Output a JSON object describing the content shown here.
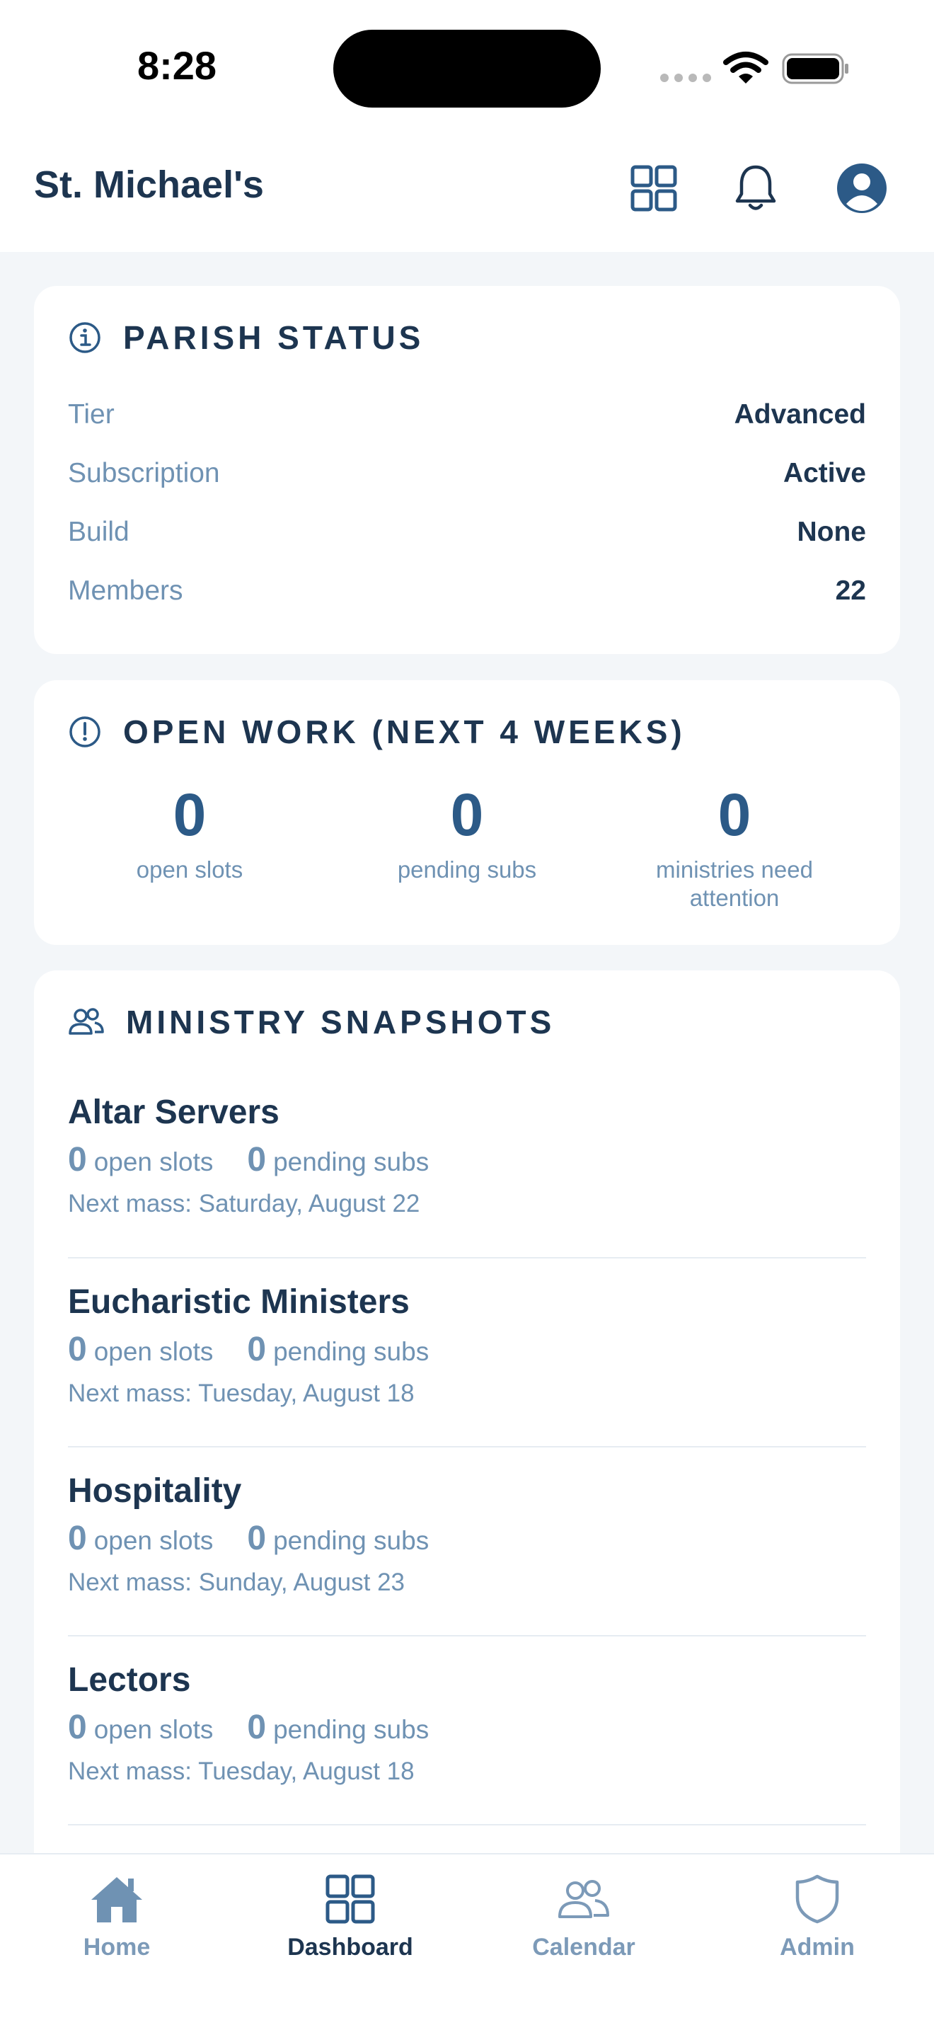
{
  "status_bar": {
    "time": "8:28"
  },
  "header": {
    "title": "St. Michael's"
  },
  "parish_status": {
    "title": "PARISH STATUS",
    "rows": [
      {
        "label": "Tier",
        "value": "Advanced"
      },
      {
        "label": "Subscription",
        "value": "Active"
      },
      {
        "label": "Build",
        "value": "None"
      },
      {
        "label": "Members",
        "value": "22"
      }
    ]
  },
  "open_work": {
    "title": "OPEN WORK (NEXT 4 WEEKS)",
    "stats": [
      {
        "value": "0",
        "label": "open slots"
      },
      {
        "value": "0",
        "label": "pending subs"
      },
      {
        "value": "0",
        "label": "ministries need attention"
      }
    ]
  },
  "ministry_snapshots": {
    "title": "MINISTRY SNAPSHOTS",
    "open_label": "open slots",
    "pending_label": "pending subs",
    "items": [
      {
        "name": "Altar Servers",
        "open": "0",
        "pending": "0",
        "next": "Next mass: Saturday, August 22"
      },
      {
        "name": "Eucharistic Ministers",
        "open": "0",
        "pending": "0",
        "next": "Next mass: Tuesday, August 18"
      },
      {
        "name": "Hospitality",
        "open": "0",
        "pending": "0",
        "next": "Next mass: Sunday, August 23"
      },
      {
        "name": "Lectors",
        "open": "0",
        "pending": "0",
        "next": "Next mass: Tuesday, August 18"
      }
    ]
  },
  "tab_bar": {
    "active": "Dashboard",
    "tabs": [
      {
        "label": "Home",
        "icon": "home-icon"
      },
      {
        "label": "Dashboard",
        "icon": "grid-icon"
      },
      {
        "label": "Calendar",
        "icon": "people-icon"
      },
      {
        "label": "Admin",
        "icon": "shield-icon"
      }
    ]
  },
  "colors": {
    "primary": "#1d3550",
    "accent": "#2c5a87",
    "muted": "#6f92b3",
    "tab_inactive": "#7c9ab8",
    "background": "#f3f6f9"
  }
}
